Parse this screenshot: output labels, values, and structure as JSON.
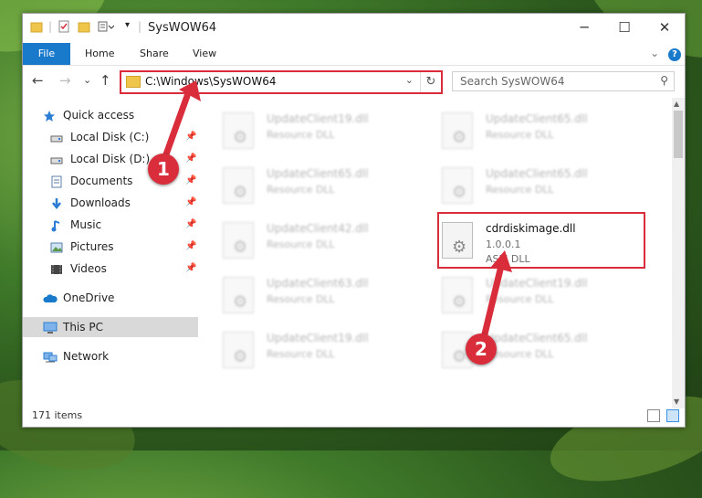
{
  "window": {
    "title": "SysWOW64",
    "controls": {
      "minimize": "─",
      "maximize": "☐",
      "close": "✕"
    }
  },
  "ribbon": {
    "tabs": [
      "File",
      "Home",
      "Share",
      "View"
    ],
    "expand_glyph": "⌄",
    "help": "?"
  },
  "address_bar": {
    "path": "C:\\Windows\\SysWOW64",
    "dropdown_glyph": "⌄",
    "refresh_glyph": "↻"
  },
  "nav_buttons": {
    "back": "←",
    "forward": "→",
    "recent": "⌄",
    "up": "↑"
  },
  "search": {
    "placeholder": "Search SysWOW64",
    "icon": "⚲"
  },
  "nav_pane": [
    {
      "label": "Quick access",
      "icon": "star-icon",
      "pinned": false
    },
    {
      "label": "Local Disk (C:)",
      "icon": "drive-icon",
      "pinned": true
    },
    {
      "label": "Local Disk (D:)",
      "icon": "drive-icon",
      "pinned": true
    },
    {
      "label": "Documents",
      "icon": "documents-icon",
      "pinned": true
    },
    {
      "label": "Downloads",
      "icon": "download-icon",
      "pinned": true
    },
    {
      "label": "Music",
      "icon": "music-icon",
      "pinned": true
    },
    {
      "label": "Pictures",
      "icon": "pictures-icon",
      "pinned": true
    },
    {
      "label": "Videos",
      "icon": "videos-icon",
      "pinned": true
    },
    {
      "label": "OneDrive",
      "icon": "cloud-icon",
      "pinned": false
    },
    {
      "label": "This PC",
      "icon": "computer-icon",
      "pinned": false,
      "selected": true
    },
    {
      "label": "Network",
      "icon": "network-icon",
      "pinned": false
    }
  ],
  "files": [
    {
      "name": "UpdateClient19.dll",
      "type": "Resource DLL"
    },
    {
      "name": "UpdateClient65.dll",
      "type": "Resource DLL"
    },
    {
      "name": "UpdateClient65.dll",
      "type": "Resource DLL"
    },
    {
      "name": "UpdateClient65.dll",
      "type": "Resource DLL"
    },
    {
      "name": "UpdateClient42.dll",
      "type": "Resource DLL"
    },
    {
      "name": "cdrdiskimage.dll",
      "version": "1.0.0.1",
      "type": "ASPI DLL",
      "highlighted": true
    },
    {
      "name": "UpdateClient63.dll",
      "type": "Resource DLL"
    },
    {
      "name": "UpdateClient19.dll",
      "type": "Resource DLL"
    },
    {
      "name": "UpdateClient19.dll",
      "type": "Resource DLL"
    },
    {
      "name": "UpdateClient65.dll",
      "type": "Resource DLL"
    }
  ],
  "status": {
    "item_count": "171 items"
  },
  "callouts": [
    "1",
    "2"
  ],
  "colors": {
    "accent": "#1979ca",
    "callout": "#d92d3c",
    "folder": "#f0c64a",
    "selected_row": "#d9d9d9"
  }
}
